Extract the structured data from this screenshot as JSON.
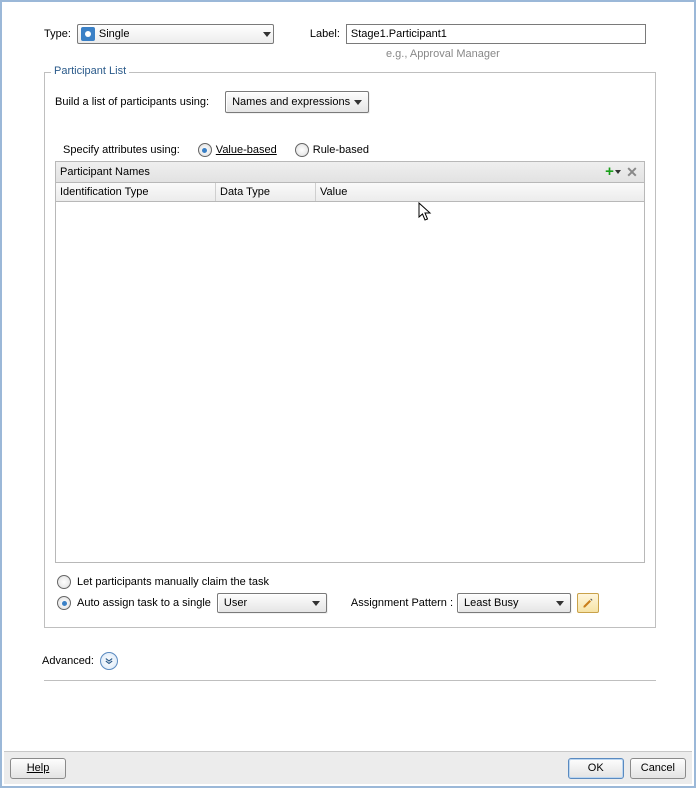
{
  "top": {
    "type_label": "Type:",
    "type_value": "Single",
    "label_label": "Label:",
    "label_value": "Stage1.Participant1",
    "label_hint": "e.g., Approval Manager"
  },
  "participant_list": {
    "legend": "Participant List",
    "build_label": "Build a list of participants using:",
    "build_value": "Names and expressions",
    "spec_label": "Specify attributes using:",
    "radio_value": "Value-based",
    "radio_rule": "Rule-based",
    "table_title": "Participant Names",
    "col_id": "Identification Type",
    "col_dt": "Data Type",
    "col_val": "Value",
    "claim_label": "Let participants manually claim the task",
    "auto_label": "Auto assign task to a single",
    "auto_value": "User",
    "assignment_pattern_label": "Assignment Pattern :",
    "assignment_pattern_value": "Least Busy"
  },
  "advanced_label": "Advanced:",
  "buttons": {
    "help": "Help",
    "ok": "OK",
    "cancel": "Cancel"
  }
}
